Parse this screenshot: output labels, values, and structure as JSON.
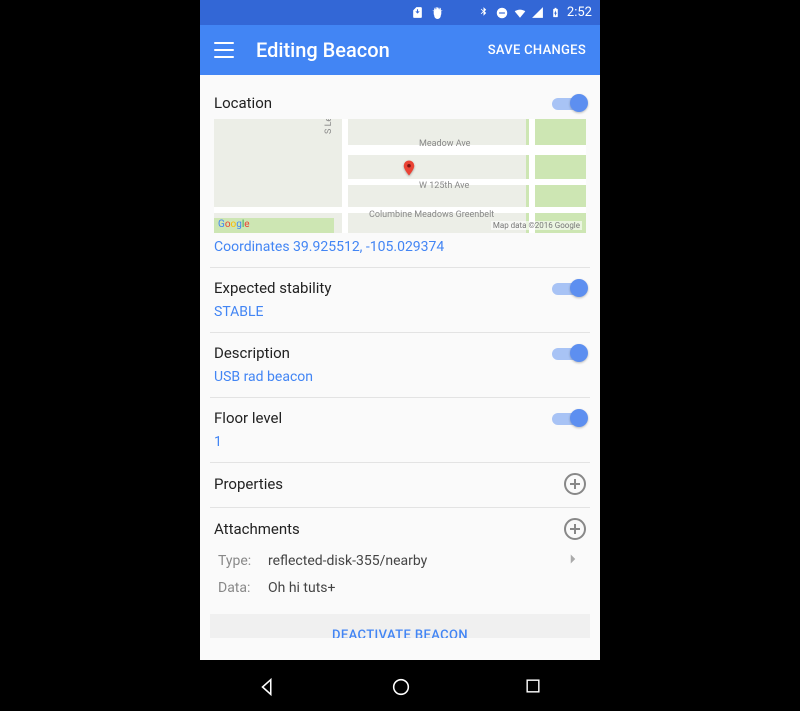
{
  "status": {
    "time": "2:52"
  },
  "appbar": {
    "title": "Editing Beacon",
    "save": "SAVE CHANGES"
  },
  "location": {
    "label": "Location",
    "coords": "Coordinates 39.925512, -105.029374",
    "map": {
      "street1": "Meadow Ave",
      "street2": "W 125th Ave",
      "street3": "Columbine Meadows Greenbelt",
      "street4": "S Lenn",
      "attribution": "Map data ©2016 Google"
    }
  },
  "stability": {
    "label": "Expected stability",
    "value": "STABLE"
  },
  "description": {
    "label": "Description",
    "value": "USB rad beacon"
  },
  "floor": {
    "label": "Floor level",
    "value": "1"
  },
  "properties": {
    "label": "Properties"
  },
  "attachments": {
    "label": "Attachments",
    "type_key": "Type:",
    "type_val": "reflected-disk-355/nearby",
    "data_key": "Data:",
    "data_val": "Oh hi tuts+"
  },
  "deactivate": "DEACTIVATE BEACON"
}
